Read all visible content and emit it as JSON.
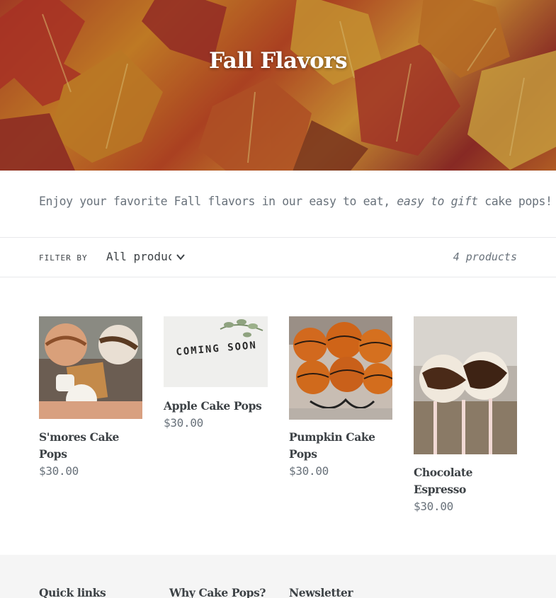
{
  "hero": {
    "title": "Fall Flavors"
  },
  "description": {
    "before": "Enjoy your favorite Fall flavors in our easy to eat, ",
    "emphasis": "easy to gift",
    "after": " cake pops!"
  },
  "filter": {
    "label": "FILTER BY",
    "selected": "All products",
    "count": "4 products"
  },
  "products": [
    {
      "title": "S'mores Cake Pops",
      "price": "$30.00"
    },
    {
      "title": "Apple Cake Pops",
      "price": "$30.00",
      "image_text": "COMING SOON"
    },
    {
      "title": "Pumpkin Cake Pops",
      "price": "$30.00"
    },
    {
      "title": "Chocolate Espresso",
      "price": "$30.00"
    }
  ],
  "footer": {
    "headings": [
      "Quick links",
      "Why Cake Pops?",
      "Newsletter"
    ]
  },
  "colors": {
    "text": "#3d4246",
    "muted": "#69727b",
    "border": "#e8e9eb",
    "footer_bg": "#f5f5f5"
  }
}
